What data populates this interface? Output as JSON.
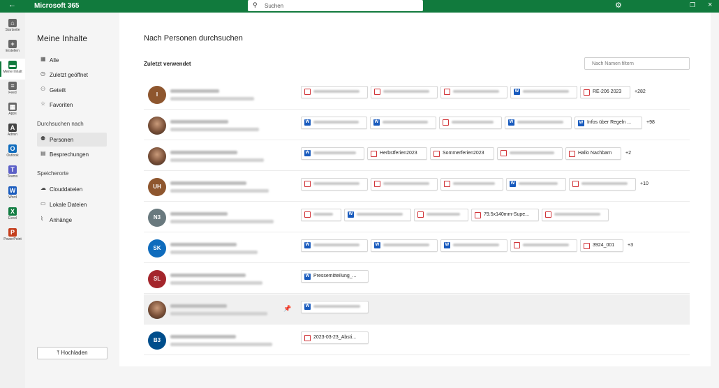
{
  "header": {
    "back_icon": "back-arrow-icon",
    "brand": "Microsoft 365",
    "search_placeholder": "Suchen",
    "settings_icon": "gear-icon",
    "restore_icon": "restore-icon",
    "close_icon": "close-icon"
  },
  "rail": [
    {
      "label": "Startseite",
      "icon": "home-icon",
      "color": "#666666"
    },
    {
      "label": "Erstellen",
      "icon": "plus-circle-icon",
      "color": "#666666"
    },
    {
      "label": "Meine Inhalt",
      "icon": "folder-icon",
      "color": "#117a3d",
      "active": true
    },
    {
      "label": "Feed",
      "icon": "feed-icon",
      "color": "#666666"
    },
    {
      "label": "Apps",
      "icon": "apps-icon",
      "color": "#666666"
    },
    {
      "label": "Admin",
      "icon": "admin-icon",
      "color": "#444444"
    },
    {
      "label": "Outlook",
      "icon": "outlook-icon",
      "color": "#0f6cbd"
    },
    {
      "label": "Teams",
      "icon": "teams-icon",
      "color": "#5b5fc7"
    },
    {
      "label": "Word",
      "icon": "word-icon",
      "color": "#185abd"
    },
    {
      "label": "Excel",
      "icon": "excel-icon",
      "color": "#107c41"
    },
    {
      "label": "PowerPoint",
      "icon": "powerpoint-icon",
      "color": "#c43e1c"
    }
  ],
  "leftnav": {
    "title": "Meine Inhalte",
    "items": [
      {
        "label": "Alle",
        "icon": "grid-icon"
      },
      {
        "label": "Zuletzt geöffnet",
        "icon": "clock-icon"
      },
      {
        "label": "Geteilt",
        "icon": "people-icon"
      },
      {
        "label": "Favoriten",
        "icon": "star-icon"
      }
    ],
    "browse_heading": "Durchsuchen nach",
    "browse": [
      {
        "label": "Personen",
        "icon": "people-group-icon",
        "selected": true
      },
      {
        "label": "Besprechungen",
        "icon": "calendar-icon"
      }
    ],
    "storage_heading": "Speicherorte",
    "storage": [
      {
        "label": "Clouddateien",
        "icon": "cloud-icon"
      },
      {
        "label": "Lokale Dateien",
        "icon": "monitor-icon"
      },
      {
        "label": "Anhänge",
        "icon": "paperclip-icon"
      }
    ],
    "upload_label": "Hochladen",
    "upload_icon": "upload-icon"
  },
  "main": {
    "title": "Nach Personen durchsuchen",
    "section": "Zuletzt verwendet",
    "filter_placeholder": "Nach Namen filtern"
  },
  "people": [
    {
      "initials": "I",
      "color": "#8e562e",
      "files": [
        {
          "type": "pdf",
          "name": "",
          "blur": true,
          "w": 96
        },
        {
          "type": "pdf",
          "name": "",
          "blur": true,
          "w": 96
        },
        {
          "type": "pdf",
          "name": "",
          "blur": true,
          "w": 96
        },
        {
          "type": "word",
          "name": "",
          "blur": true,
          "w": 96
        },
        {
          "type": "pdf",
          "name": "RE-206 2023",
          "blur": false,
          "w": 72
        }
      ],
      "more": "+282"
    },
    {
      "initials": "",
      "color": "#5a4a42",
      "photo": true,
      "files": [
        {
          "type": "word",
          "name": "",
          "blur": true,
          "w": 95
        },
        {
          "type": "word",
          "name": "",
          "blur": true,
          "w": 95
        },
        {
          "type": "pdf",
          "name": "",
          "blur": true,
          "w": 90
        },
        {
          "type": "word",
          "name": "",
          "blur": true,
          "w": 96
        },
        {
          "type": "word",
          "name": "Infos über Regeln ...",
          "blur": false,
          "w": 97
        }
      ],
      "more": "+98"
    },
    {
      "initials": "",
      "color": "#8a5a40",
      "photo": true,
      "files": [
        {
          "type": "word",
          "name": "",
          "blur": true,
          "w": 91
        },
        {
          "type": "pdf",
          "name": "Herbstferien2023",
          "blur": false,
          "w": 86
        },
        {
          "type": "pdf",
          "name": "Sommerferien2023",
          "blur": false,
          "w": 92
        },
        {
          "type": "pdf",
          "name": "",
          "blur": true,
          "w": 94
        },
        {
          "type": "pdf",
          "name": "Hallo Nachbarn",
          "blur": false,
          "w": 80
        }
      ],
      "more": "+2"
    },
    {
      "initials": "UH",
      "color": "#8e562e",
      "files": [
        {
          "type": "pdf",
          "name": "",
          "blur": true,
          "w": 96
        },
        {
          "type": "pdf",
          "name": "",
          "blur": true,
          "w": 96
        },
        {
          "type": "pdf",
          "name": "",
          "blur": true,
          "w": 90
        },
        {
          "type": "word",
          "name": "",
          "blur": true,
          "w": 86
        },
        {
          "type": "pdf",
          "name": "",
          "blur": true,
          "w": 96
        }
      ],
      "more": "+10"
    },
    {
      "initials": "N3",
      "color": "#69797e",
      "files": [
        {
          "type": "pdf",
          "name": "",
          "blur": true,
          "w": 58
        },
        {
          "type": "word",
          "name": "",
          "blur": true,
          "w": 96
        },
        {
          "type": "pdf",
          "name": "",
          "blur": true,
          "w": 78
        },
        {
          "type": "pdf",
          "name": "79.5x140mm-Supe...",
          "blur": false,
          "w": 97
        },
        {
          "type": "pdf",
          "name": "",
          "blur": true,
          "w": 96
        }
      ],
      "more": ""
    },
    {
      "initials": "SK",
      "color": "#0f6cbd",
      "files": [
        {
          "type": "word",
          "name": "",
          "blur": true,
          "w": 96
        },
        {
          "type": "word",
          "name": "",
          "blur": true,
          "w": 96
        },
        {
          "type": "word",
          "name": "",
          "blur": true,
          "w": 96
        },
        {
          "type": "pdf",
          "name": "",
          "blur": true,
          "w": 96
        },
        {
          "type": "pdf",
          "name": "3924_001",
          "blur": false,
          "w": 62
        }
      ],
      "more": "+3"
    },
    {
      "initials": "SL",
      "color": "#a4262c",
      "files": [
        {
          "type": "word",
          "name": "Pressemitteilung_...",
          "blur": false,
          "w": 97
        }
      ],
      "more": ""
    },
    {
      "initials": "",
      "color": "#7a5038",
      "photo": true,
      "hover": true,
      "pin": true,
      "files": [
        {
          "type": "word",
          "name": "",
          "blur": true,
          "w": 97
        }
      ],
      "more": ""
    },
    {
      "initials": "B3",
      "color": "#004e8c",
      "files": [
        {
          "type": "pdf",
          "name": "2023-03-23_Absti...",
          "blur": false,
          "w": 97
        }
      ],
      "more": ""
    }
  ]
}
